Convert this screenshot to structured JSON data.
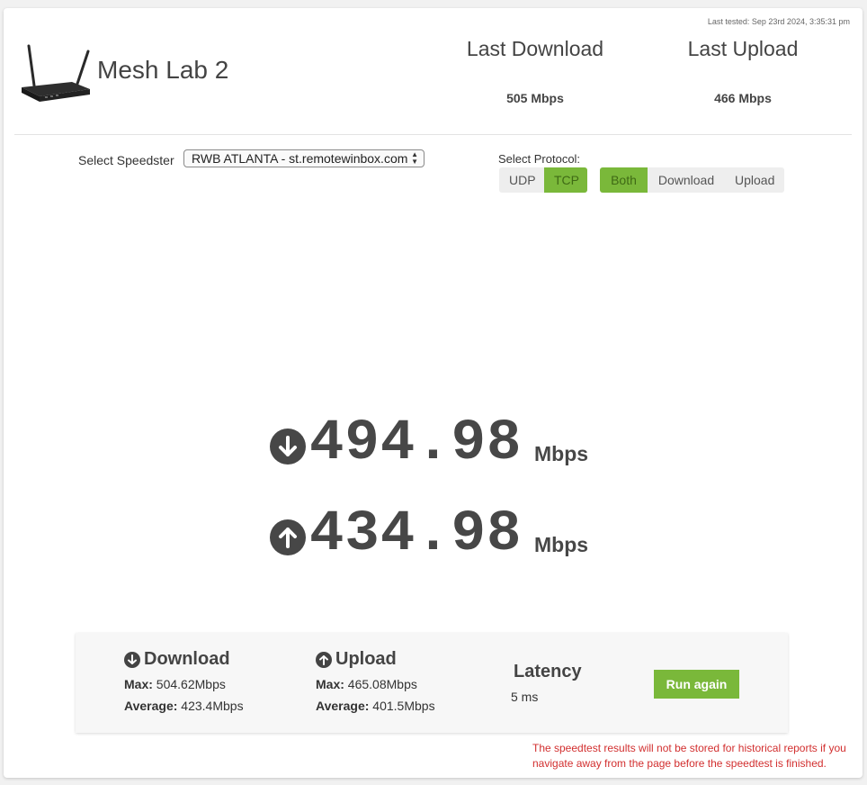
{
  "header": {
    "last_tested": "Last tested: Sep 23rd 2024, 3:35:31 pm",
    "device_name": "Mesh Lab 2",
    "last_download_label": "Last Download",
    "last_download_value": "505 Mbps",
    "last_upload_label": "Last Upload",
    "last_upload_value": "466 Mbps"
  },
  "controls": {
    "speedster_label": "Select Speedster",
    "speedster_value": "RWB ATLANTA - st.remotewinbox.com",
    "protocol_label": "Select Protocol:",
    "protocol_options": [
      {
        "label": "UDP",
        "active": false
      },
      {
        "label": "TCP",
        "active": true
      }
    ],
    "direction_options": [
      {
        "label": "Both",
        "active": true
      },
      {
        "label": "Download",
        "active": false
      },
      {
        "label": "Upload",
        "active": false
      }
    ]
  },
  "live": {
    "download_value": "494.98",
    "upload_value": "434.98",
    "unit": "Mbps"
  },
  "summary": {
    "download_title": "Download",
    "download_max_label": "Max:",
    "download_max_value": "504.62Mbps",
    "download_avg_label": "Average:",
    "download_avg_value": "423.4Mbps",
    "upload_title": "Upload",
    "upload_max_label": "Max:",
    "upload_max_value": "465.08Mbps",
    "upload_avg_label": "Average:",
    "upload_avg_value": "401.5Mbps",
    "latency_title": "Latency",
    "latency_value": "5 ms",
    "run_again": "Run again"
  },
  "warning": "The speedtest results will not be stored for historical reports if you navigate away from the page before the speedtest is finished.",
  "colors": {
    "accent_green": "#7ab83a",
    "warning_red": "#d22f2f"
  },
  "icons": {
    "device": "router-icon",
    "download": "arrow-down-circle-icon",
    "upload": "arrow-up-circle-icon"
  }
}
